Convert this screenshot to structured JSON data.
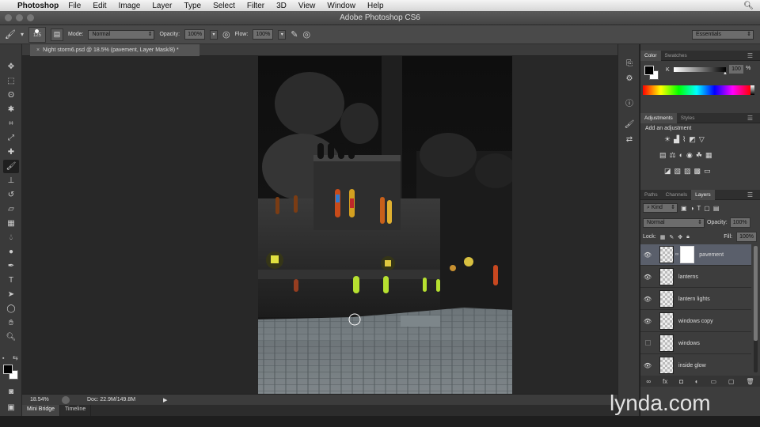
{
  "menubar": {
    "app": "Photoshop",
    "items": [
      "File",
      "Edit",
      "Image",
      "Layer",
      "Type",
      "Select",
      "Filter",
      "3D",
      "View",
      "Window",
      "Help"
    ]
  },
  "window_title": "Adobe Photoshop CS6",
  "options_bar": {
    "brush_size": "125",
    "mode_label": "Mode:",
    "mode_value": "Normal",
    "opacity_label": "Opacity:",
    "opacity_value": "100%",
    "flow_label": "Flow:",
    "flow_value": "100%",
    "workspace": "Essentials"
  },
  "document_tab": "Night storm6.psd @ 18.5% (pavement, Layer Mask/8) *",
  "status": {
    "zoom": "18.54%",
    "doc": "Doc: 22.9M/149.8M"
  },
  "bottom_tabs": [
    "Mini Bridge",
    "Timeline"
  ],
  "color_panel": {
    "tabs": [
      "Color",
      "Swatches"
    ],
    "channel": "K",
    "value": "100",
    "value_unit": "%"
  },
  "adjustments_panel": {
    "tabs": [
      "Adjustments",
      "Styles"
    ],
    "hint": "Add an adjustment"
  },
  "layers_panel": {
    "tabs": [
      "Paths",
      "Channels",
      "Layers"
    ],
    "filter_kind": "Kind",
    "blend_mode": "Normal",
    "opacity_label": "Opacity:",
    "opacity_value": "100%",
    "lock_label": "Lock:",
    "fill_label": "Fill:",
    "fill_value": "100%",
    "layers": [
      {
        "name": "pavement",
        "visible": true,
        "selected": true
      },
      {
        "name": "lanterns",
        "visible": true,
        "selected": false
      },
      {
        "name": "lantern lights",
        "visible": true,
        "selected": false
      },
      {
        "name": "windows copy",
        "visible": true,
        "selected": false
      },
      {
        "name": "windows",
        "visible": false,
        "selected": false
      },
      {
        "name": "inside glow",
        "visible": true,
        "selected": false
      }
    ]
  },
  "watermark": "lynda.com",
  "colors": {
    "accent_selected_layer": "#5a5f6b",
    "panel_bg": "#3d3d3d"
  }
}
